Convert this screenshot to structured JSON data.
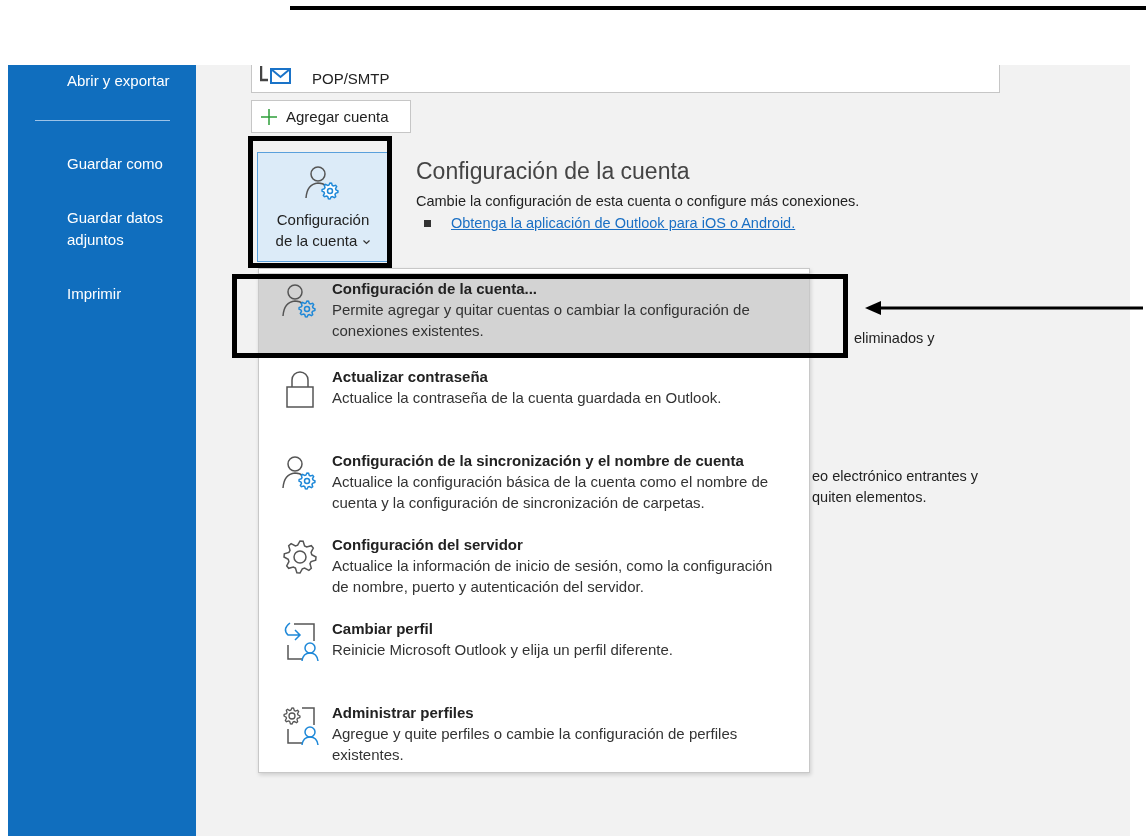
{
  "sidebar": {
    "items": [
      {
        "kind": "item",
        "label": "Abrir y exportar"
      },
      {
        "kind": "divider"
      },
      {
        "kind": "item",
        "label": "Guardar como"
      },
      {
        "kind": "item",
        "label": "Guardar datos adjuntos"
      },
      {
        "kind": "item",
        "label": "Imprimir"
      }
    ]
  },
  "account_select": {
    "value": "POP/SMTP"
  },
  "add_account_button": {
    "label": "Agregar cuenta"
  },
  "account_settings_button": {
    "label": "Configuración de la cuenta",
    "expanded": true
  },
  "section": {
    "title": "Configuración de la cuenta",
    "description": "Cambie la configuración de esta cuenta o configure más conexiones.",
    "links": [
      "Obtenga la aplicación de Outlook para iOS o Android."
    ]
  },
  "background_texts": [
    "eliminados y",
    "eo electrónico entrantes y",
    "quiten elementos."
  ],
  "menu": {
    "items": [
      {
        "kind": "account",
        "title": "Configuración de la cuenta...",
        "description": "Permite agregar y quitar cuentas o cambiar la configuración de conexiones existentes.",
        "selected": true
      },
      {
        "kind": "password",
        "title": "Actualizar contraseña",
        "description": "Actualice la contraseña de la cuenta guardada en Outlook.",
        "selected": false
      },
      {
        "kind": "sync",
        "title": "Configuración de la sincronización y el nombre de cuenta",
        "description": "Actualice la configuración básica de la cuenta como el nombre de cuenta y la configuración de sincronización de carpetas.",
        "selected": false
      },
      {
        "kind": "server",
        "title": "Configuración del servidor",
        "description": "Actualice la información de inicio de sesión, como la configuración de nombre, puerto y autenticación del servidor.",
        "selected": false
      },
      {
        "kind": "change_profile",
        "title": "Cambiar perfil",
        "description": "Reinicie Microsoft Outlook y elija un perfil diferente.",
        "selected": false
      },
      {
        "kind": "manage_profiles",
        "title": "Administrar perfiles",
        "description": "Agregue y quite perfiles o cambie la configuración de perfiles existentes.",
        "selected": false
      }
    ]
  }
}
